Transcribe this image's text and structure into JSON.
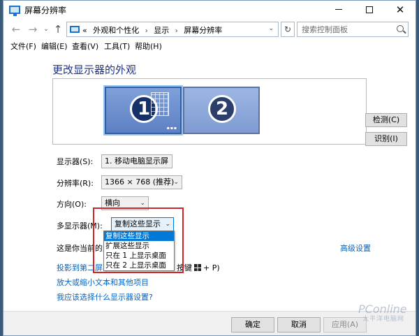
{
  "window": {
    "title": "屏幕分辨率",
    "minimize": "—",
    "close": "✕"
  },
  "nav": {
    "back": "←",
    "forward": "→",
    "history": "⌄",
    "up": "↑",
    "breadcrumb_prefix": "«",
    "breadcrumbs": [
      "外观和个性化",
      "显示",
      "屏幕分辨率"
    ],
    "refresh": "↻",
    "search_placeholder": "搜索控制面板"
  },
  "menu": [
    "文件(F)",
    "编辑(E)",
    "查看(V)",
    "工具(T)",
    "帮助(H)"
  ],
  "content": {
    "heading": "更改显示器的外观",
    "monitors": [
      {
        "number": "1",
        "selected": true
      },
      {
        "number": "2",
        "selected": false
      }
    ],
    "detect_button": "检测(C)",
    "identify_button": "识别(I)",
    "display_label": "显示器(S):",
    "display_value": "1. 移动电脑显示屏",
    "resolution_label": "分辨率(R):",
    "resolution_value": "1366 × 768 (推荐)",
    "orientation_label": "方向(O):",
    "orientation_value": "横向",
    "multi_label": "多显示器(M):",
    "multi_value": "复制这些显示",
    "multi_options": [
      "复制这些显示",
      "扩展这些显示",
      "只在 1 上显示桌面",
      "只在 2 上显示桌面"
    ],
    "current_text": "这是你当前的主",
    "advanced_link": "高级设置",
    "project_link": "投影到第二屏幕",
    "project_shortcut_pre": "按键",
    "project_shortcut_post": "+ P)",
    "text_size_link": "放大或缩小文本和其他项目",
    "which_link": "我应该选择什么显示器设置?"
  },
  "footer": {
    "ok": "确定",
    "cancel": "取消",
    "apply": "应用(A)"
  },
  "watermark": {
    "brand": "PConline",
    "sub": "太平洋电脑网"
  },
  "colors": {
    "accent": "#0078d7",
    "link": "#0563c1",
    "heading": "#1e3287",
    "highlight": "#d2232a"
  }
}
